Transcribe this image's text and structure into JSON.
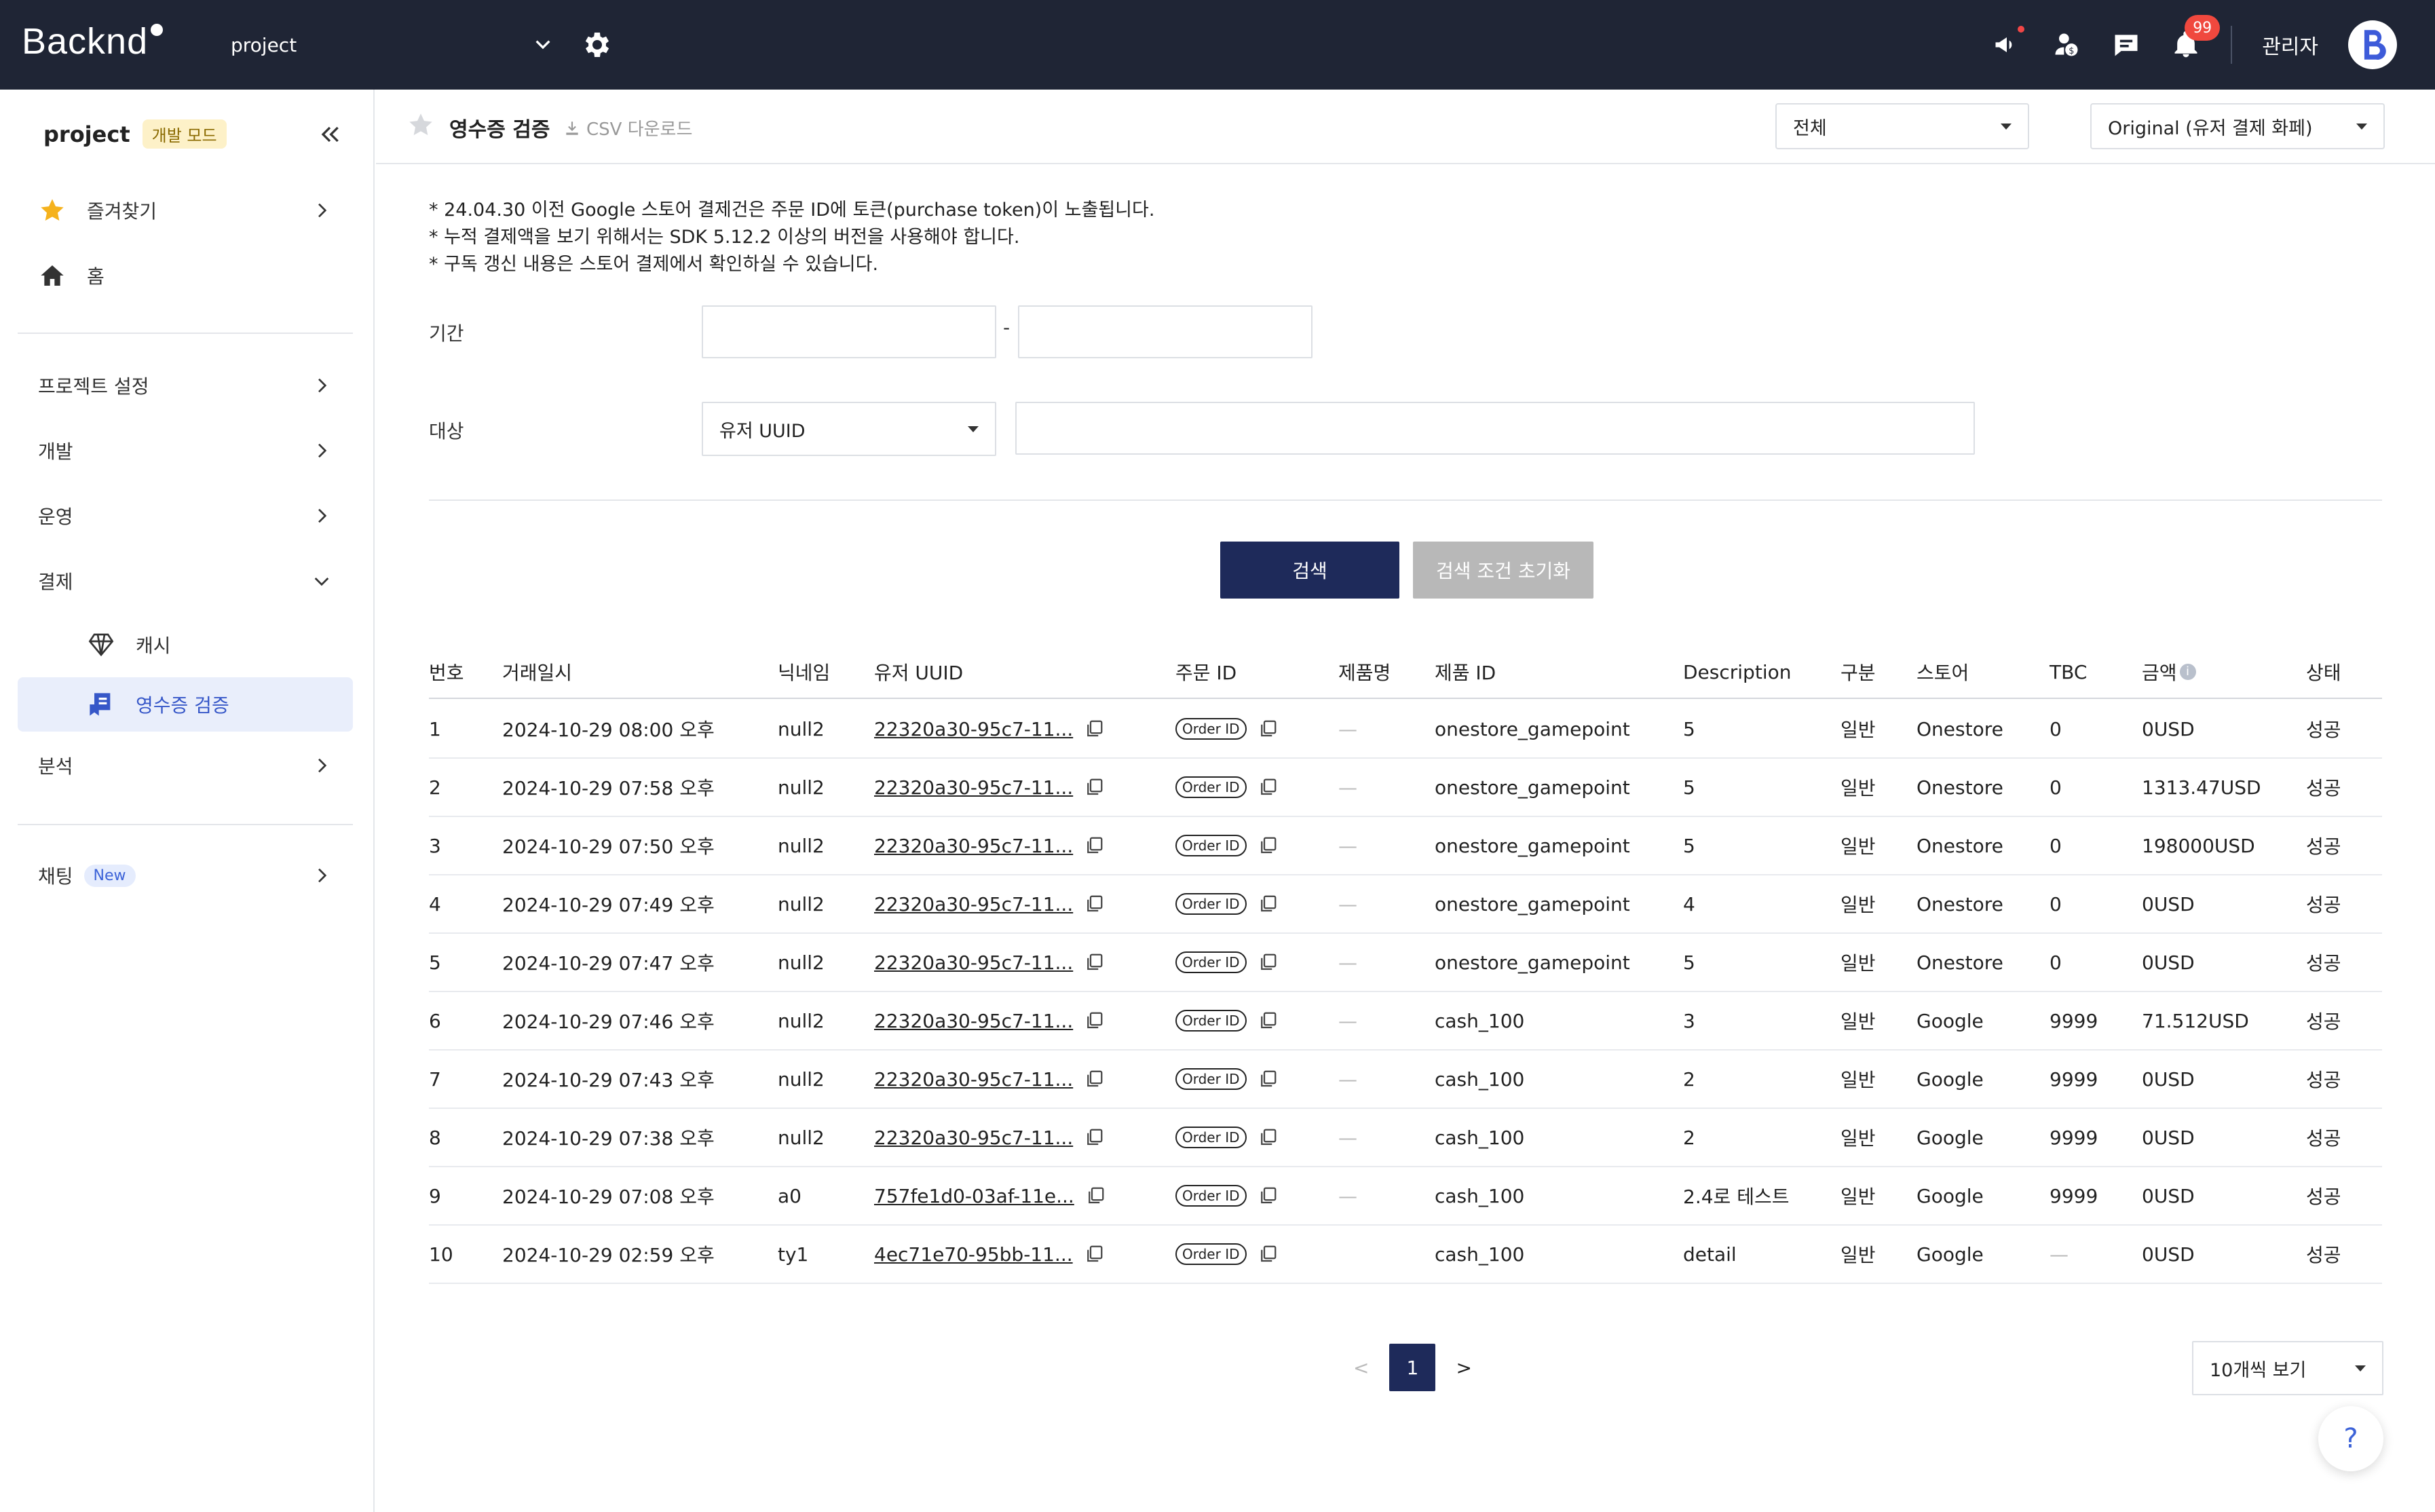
{
  "header": {
    "logo": "Backnd",
    "project": "project",
    "notification_count": "99",
    "admin_label": "관리자",
    "icons": [
      "megaphone-icon",
      "coin-user-icon",
      "chat-icon",
      "bell-icon"
    ]
  },
  "sidebar": {
    "project_name": "project",
    "mode_badge": "개발 모드",
    "items": {
      "favorites": "즐겨찾기",
      "home": "홈",
      "project_settings": "프로젝트 설정",
      "development": "개발",
      "operation": "운영",
      "payment": "결제",
      "cash": "캐시",
      "receipt": "영수증 검증",
      "analytics": "분석",
      "chat": "채팅",
      "chat_badge": "New"
    }
  },
  "page": {
    "title": "영수증 검증",
    "csv_download": "CSV 다운로드",
    "filter_all": "전체",
    "filter_view": "Original (유저 결제 화페)",
    "notes": [
      "* 24.04.30 이전 Google 스토어 결제건은 주문 ID에 토큰(purchase token)이 노출됩니다.",
      "* 누적 결제액을 보기 위해서는 SDK 5.12.2 이상의 버전을 사용해야 합니다.",
      "* 구독 갱신 내용은 스토어 결제에서 확인하실 수 있습니다."
    ],
    "period_label": "기간",
    "period_separator": "-",
    "target_label": "대상",
    "target_select": "유저 UUID",
    "search_button": "검색",
    "reset_button": "검색 조건 초기화"
  },
  "table": {
    "headers": [
      "번호",
      "거래일시",
      "닉네임",
      "유저 UUID",
      "주문 ID",
      "제품명",
      "제품 ID",
      "Description",
      "구분",
      "스토어",
      "TBC",
      "금액",
      "상태"
    ],
    "order_id_label": "Order ID",
    "rows": [
      [
        "1",
        "2024-10-29 08:00 오후",
        "null2",
        "22320a30-95c7-11...",
        "Order ID",
        "—",
        "onestore_gamepoint",
        "5",
        "일반",
        "Onestore",
        "0",
        "0USD",
        "성공"
      ],
      [
        "2",
        "2024-10-29 07:58 오후",
        "null2",
        "22320a30-95c7-11...",
        "Order ID",
        "—",
        "onestore_gamepoint",
        "5",
        "일반",
        "Onestore",
        "0",
        "1313.47USD",
        "성공"
      ],
      [
        "3",
        "2024-10-29 07:50 오후",
        "null2",
        "22320a30-95c7-11...",
        "Order ID",
        "—",
        "onestore_gamepoint",
        "5",
        "일반",
        "Onestore",
        "0",
        "198000USD",
        "성공"
      ],
      [
        "4",
        "2024-10-29 07:49 오후",
        "null2",
        "22320a30-95c7-11...",
        "Order ID",
        "—",
        "onestore_gamepoint",
        "4",
        "일반",
        "Onestore",
        "0",
        "0USD",
        "성공"
      ],
      [
        "5",
        "2024-10-29 07:47 오후",
        "null2",
        "22320a30-95c7-11...",
        "Order ID",
        "—",
        "onestore_gamepoint",
        "5",
        "일반",
        "Onestore",
        "0",
        "0USD",
        "성공"
      ],
      [
        "6",
        "2024-10-29 07:46 오후",
        "null2",
        "22320a30-95c7-11...",
        "Order ID",
        "—",
        "cash_100",
        "3",
        "일반",
        "Google",
        "9999",
        "71.512USD",
        "성공"
      ],
      [
        "7",
        "2024-10-29 07:43 오후",
        "null2",
        "22320a30-95c7-11...",
        "Order ID",
        "—",
        "cash_100",
        "2",
        "일반",
        "Google",
        "9999",
        "0USD",
        "성공"
      ],
      [
        "8",
        "2024-10-29 07:38 오후",
        "null2",
        "22320a30-95c7-11...",
        "Order ID",
        "—",
        "cash_100",
        "2",
        "일반",
        "Google",
        "9999",
        "0USD",
        "성공"
      ],
      [
        "9",
        "2024-10-29 07:08 오후",
        "a0",
        "757fe1d0-03af-11e...",
        "Order ID",
        "—",
        "cash_100",
        "2.4로 테스트",
        "일반",
        "Google",
        "9999",
        "0USD",
        "성공"
      ],
      [
        "10",
        "2024-10-29 02:59 오후",
        "ty1",
        "4ec71e70-95bb-11...",
        "Order ID",
        "",
        "cash_100",
        "detail",
        "일반",
        "Google",
        "—",
        "0USD",
        "성공"
      ]
    ]
  },
  "pagination": {
    "prev": "<",
    "current": "1",
    "next": ">",
    "page_size": "10개씩 보기"
  },
  "help": "?"
}
